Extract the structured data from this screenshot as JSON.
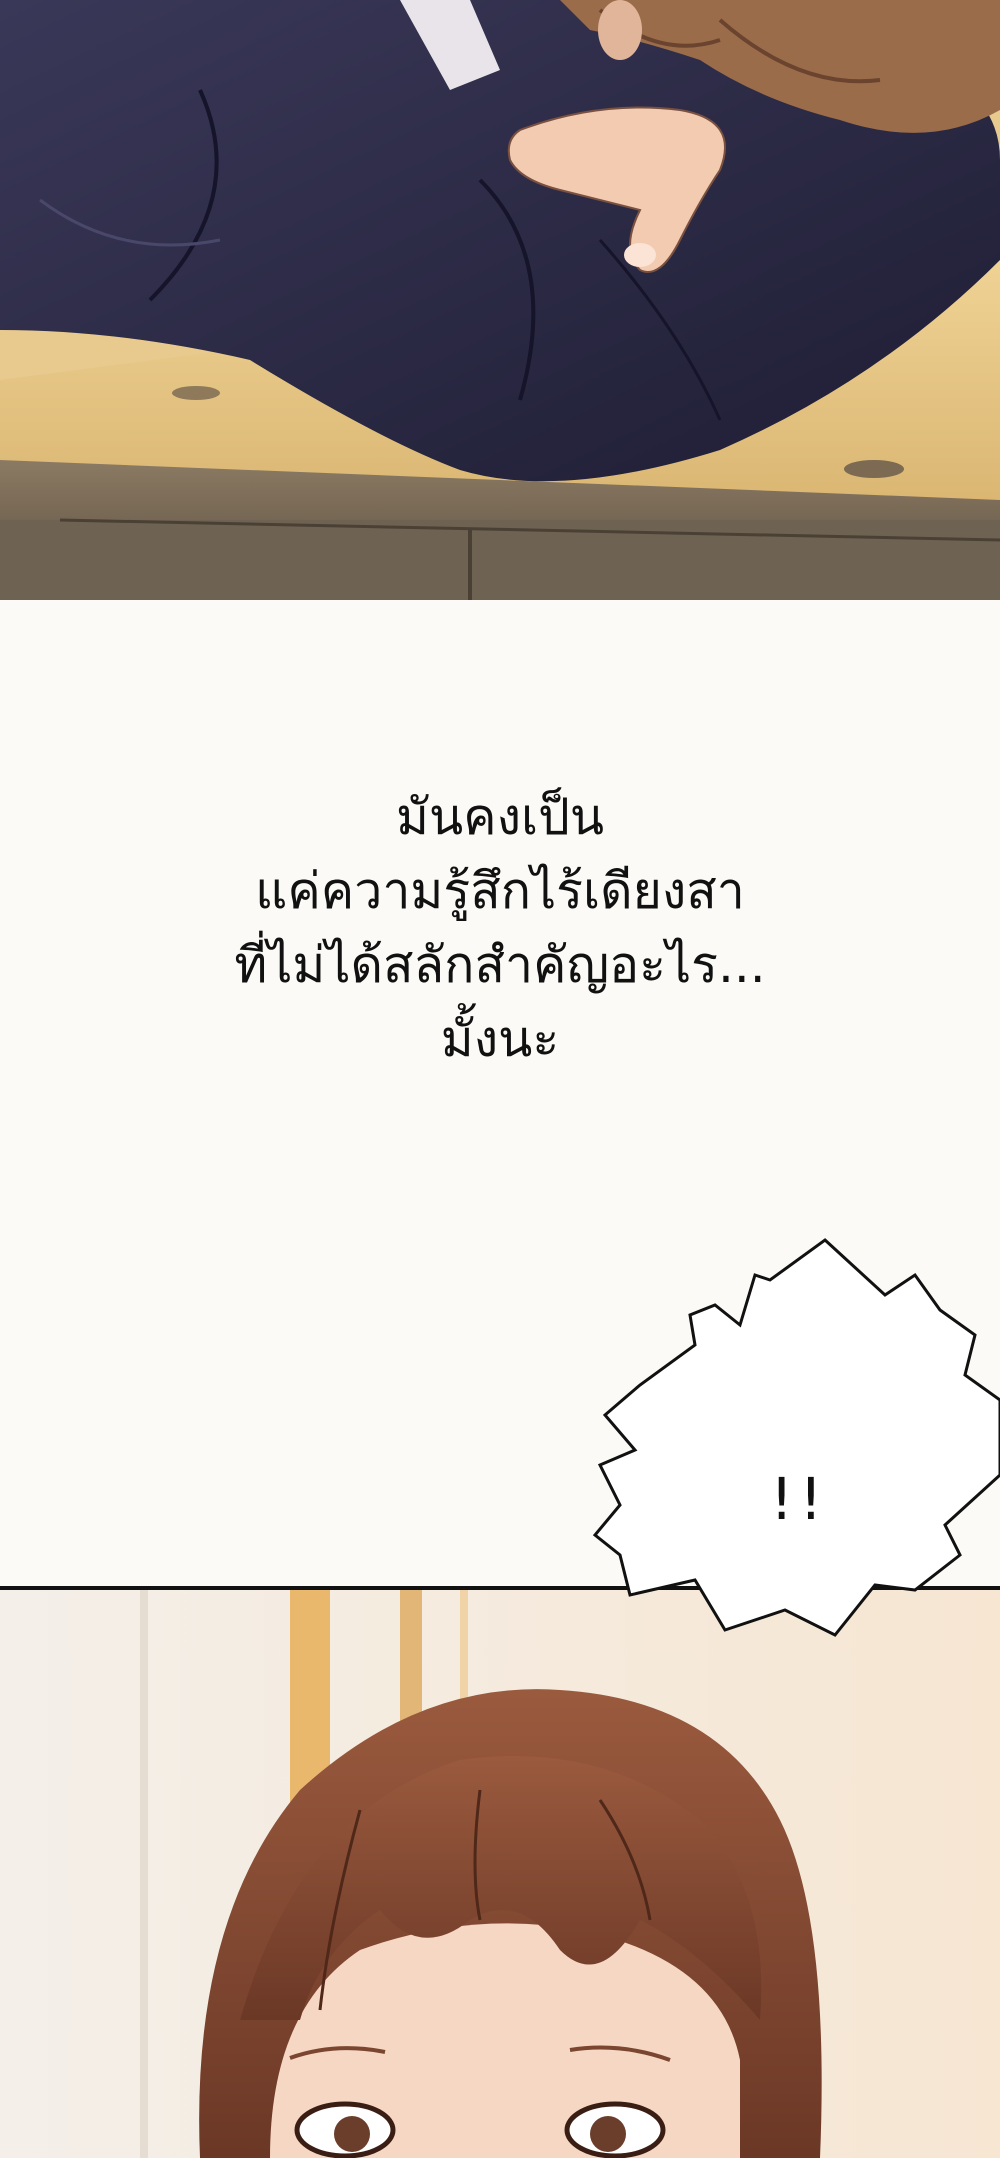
{
  "narration": {
    "line1": "มันคงเป็น",
    "line2": "แค่ความรู้สึกไร้เดียงสา",
    "line3": "ที่ไม่ได้สลักสำคัญอะไร...",
    "line4": "มั้งนะ"
  },
  "speech_bubble": {
    "text": "!!"
  },
  "colors": {
    "page_background": "#fbfaf6",
    "suit_navy": "#2b2a45",
    "desk_wood": "#e6c684",
    "hair_brown": "#8a4e36",
    "skin": "#f4d3be",
    "panel_border": "#111111"
  }
}
